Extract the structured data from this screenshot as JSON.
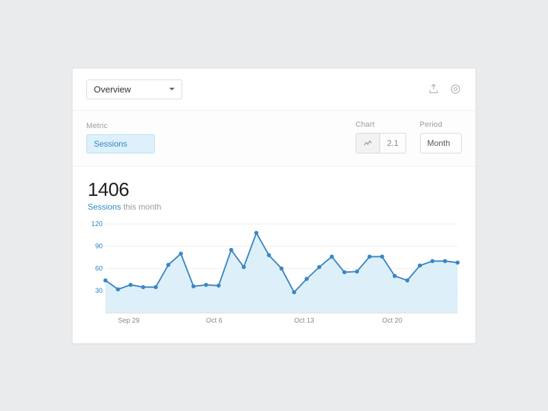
{
  "header": {
    "view_selector": "Overview"
  },
  "filters": {
    "metric_label": "Metric",
    "metric_value": "Sessions",
    "chart_label": "Chart",
    "chart_value": "2.1",
    "period_label": "Period",
    "period_value": "Month"
  },
  "summary": {
    "value": "1406",
    "metric": "Sessions",
    "suffix": " this month"
  },
  "chart_data": {
    "type": "area",
    "title": "",
    "xlabel": "",
    "ylabel": "",
    "ylim": [
      0,
      120
    ],
    "yticks": [
      30,
      60,
      90,
      120
    ],
    "xticks": [
      "Sep 29",
      "Oct 6",
      "Oct 13",
      "Oct 20"
    ],
    "xtick_positions": [
      1,
      8,
      15,
      22
    ],
    "series": [
      {
        "name": "Sessions",
        "x": [
          0,
          1,
          2,
          3,
          4,
          5,
          6,
          7,
          8,
          9,
          10,
          11,
          12,
          13,
          14,
          15,
          16,
          17,
          18,
          19,
          20,
          21,
          22,
          23,
          24,
          25,
          26,
          27,
          28
        ],
        "values": [
          44,
          32,
          38,
          35,
          35,
          65,
          80,
          36,
          38,
          37,
          85,
          62,
          108,
          78,
          60,
          28,
          46,
          62,
          76,
          55,
          56,
          76,
          76,
          50,
          44,
          64,
          70,
          70,
          68
        ]
      }
    ]
  }
}
